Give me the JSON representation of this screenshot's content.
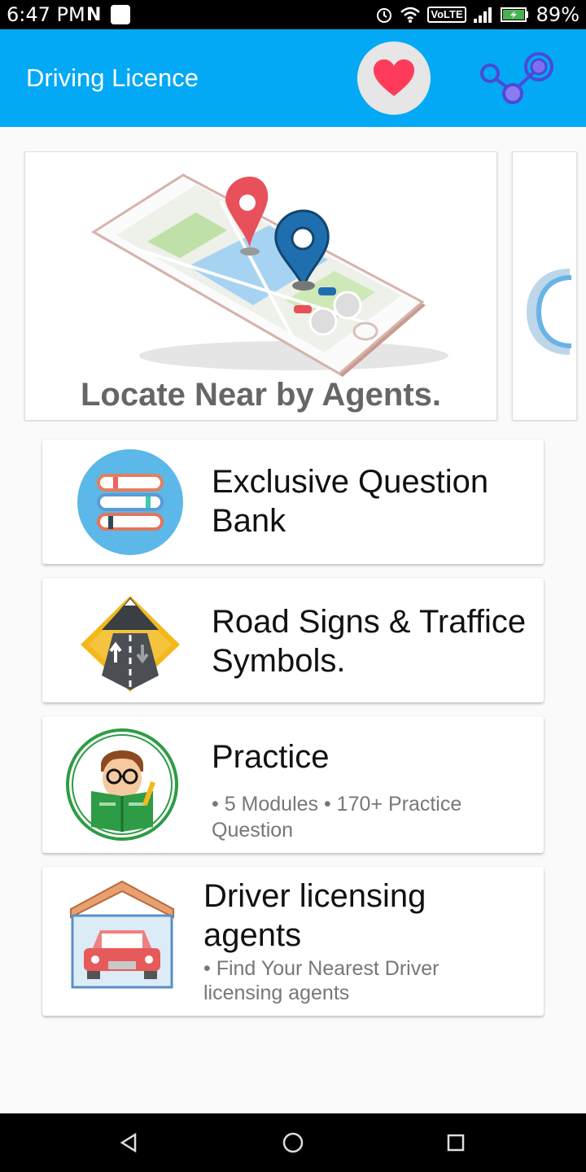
{
  "status_bar": {
    "time": "6:47 PM",
    "notification_letter": "N",
    "volte": "VoLTE",
    "battery": "89%"
  },
  "app_bar": {
    "title": "Driving Licence",
    "favorite_icon": "heart-icon",
    "share_icon": "share-nodes-icon",
    "bar_color": "#03a9f4",
    "heart_color": "#ff3b5c"
  },
  "carousel": {
    "slides": [
      {
        "caption": "Locate Near by Agents.",
        "image": "phone-map-pins"
      }
    ]
  },
  "menu": [
    {
      "title": "Exclusive Question Bank",
      "icon": "books-icon"
    },
    {
      "title": "Road Signs & Traffice Symbols.",
      "icon": "road-sign-icon"
    },
    {
      "title": "Practice",
      "subtitle": "• 5 Modules • 170+ Practice Question",
      "icon": "student-reading-icon"
    },
    {
      "title": "Driver licensing agents",
      "subtitle": "• Find Your Nearest Driver licensing agents",
      "icon": "garage-car-icon"
    }
  ],
  "nav_bar": {
    "back_icon": "back-triangle-icon",
    "home_icon": "home-circle-icon",
    "recents_icon": "recents-square-icon"
  }
}
